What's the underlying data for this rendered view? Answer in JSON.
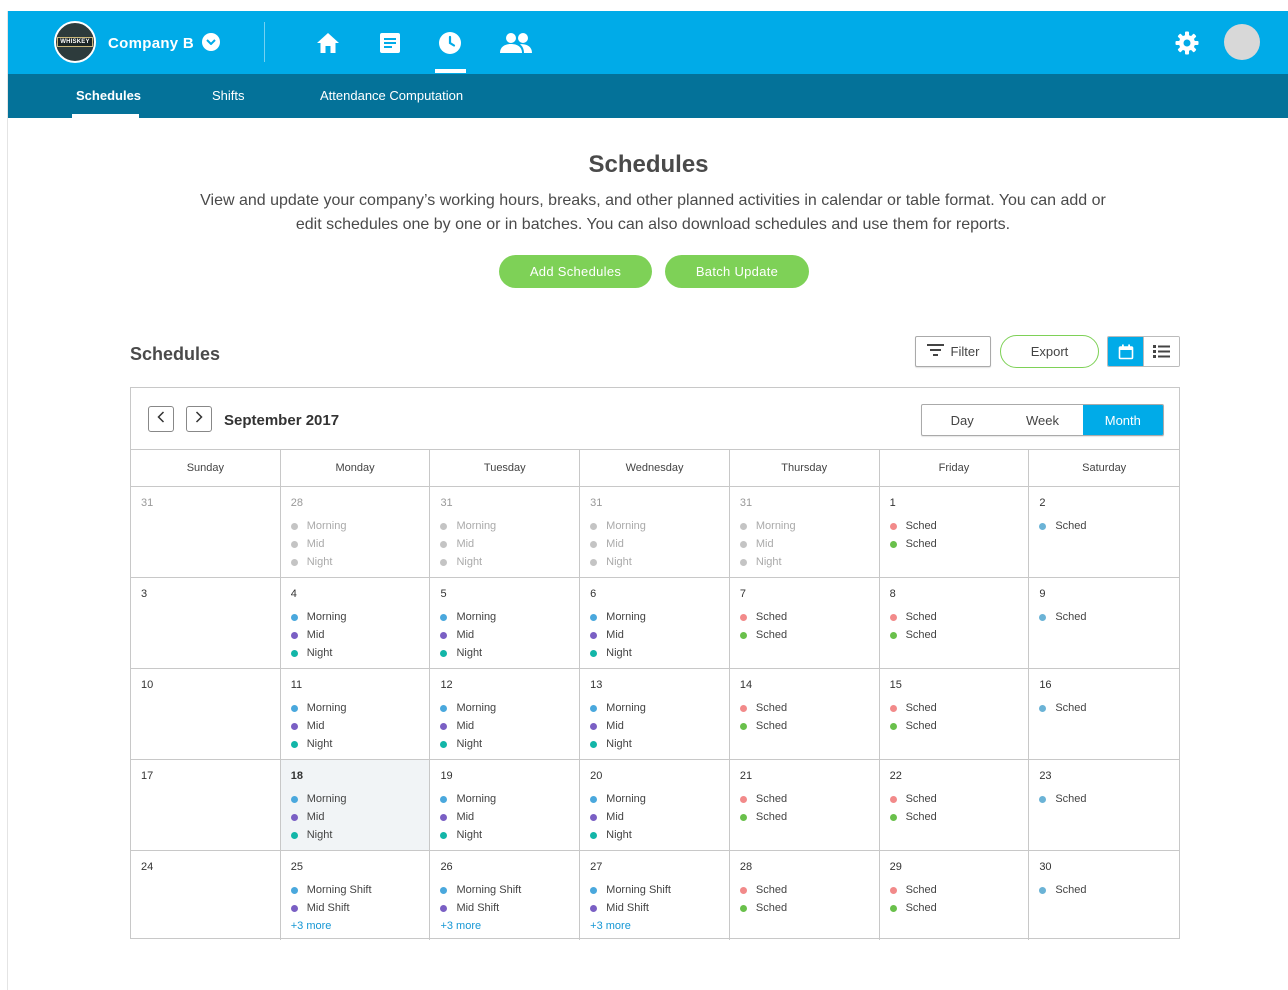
{
  "header": {
    "logo_text": "WHISKEY",
    "company_name": "Company B"
  },
  "nav_icons": [
    "home-icon",
    "document-icon",
    "clock-icon",
    "people-icon"
  ],
  "subnav": {
    "tabs": [
      "Schedules",
      "Shifts",
      "Attendance Computation"
    ]
  },
  "hero": {
    "title": "Schedules",
    "description": "View and update your company’s working hours, breaks, and other planned activities in calendar or table format. You can add or edit schedules one by one or in batches. You can also download schedules and use them for reports.",
    "add_label": "Add Schedules",
    "batch_label": "Batch Update"
  },
  "section": {
    "title": "Schedules",
    "filter_label": "Filter",
    "export_label": "Export"
  },
  "calendar": {
    "month": "September 2017",
    "views": [
      "Day",
      "Week",
      "Month"
    ],
    "active_view": "Month",
    "weekdays": [
      "Sunday",
      "Monday",
      "Tuesday",
      "Wednesday",
      "Thursday",
      "Friday",
      "Saturday"
    ]
  },
  "colors": {
    "accent": "#00abe8",
    "subnav": "#047299",
    "green": "#7ed157",
    "morning": "#4aa8dd",
    "mid": "#7a5fc4",
    "night": "#12b6a8",
    "sched_red": "#f28a8a",
    "sched_green": "#69c04b",
    "sched_blue": "#6bb3d6",
    "faded": "#c4c4c4",
    "more_link": "#1597d4"
  },
  "weeks": [
    [
      {
        "num": "31",
        "out": true,
        "events": []
      },
      {
        "num": "28",
        "out": true,
        "events": [
          [
            "Morning",
            "faded"
          ],
          [
            "Mid",
            "faded"
          ],
          [
            "Night",
            "faded"
          ]
        ]
      },
      {
        "num": "31",
        "out": true,
        "events": [
          [
            "Morning",
            "faded"
          ],
          [
            "Mid",
            "faded"
          ],
          [
            "Night",
            "faded"
          ]
        ]
      },
      {
        "num": "31",
        "out": true,
        "events": [
          [
            "Morning",
            "faded"
          ],
          [
            "Mid",
            "faded"
          ],
          [
            "Night",
            "faded"
          ]
        ]
      },
      {
        "num": "31",
        "out": true,
        "events": [
          [
            "Morning",
            "faded"
          ],
          [
            "Mid",
            "faded"
          ],
          [
            "Night",
            "faded"
          ]
        ]
      },
      {
        "num": "1",
        "events": [
          [
            "Sched",
            "sched_red"
          ],
          [
            "Sched",
            "sched_green"
          ]
        ]
      },
      {
        "num": "2",
        "events": [
          [
            "Sched",
            "sched_blue"
          ]
        ]
      }
    ],
    [
      {
        "num": "3",
        "events": []
      },
      {
        "num": "4",
        "events": [
          [
            "Morning",
            "morning"
          ],
          [
            "Mid",
            "mid"
          ],
          [
            "Night",
            "night"
          ]
        ]
      },
      {
        "num": "5",
        "events": [
          [
            "Morning",
            "morning"
          ],
          [
            "Mid",
            "mid"
          ],
          [
            "Night",
            "night"
          ]
        ]
      },
      {
        "num": "6",
        "events": [
          [
            "Morning",
            "morning"
          ],
          [
            "Mid",
            "mid"
          ],
          [
            "Night",
            "night"
          ]
        ]
      },
      {
        "num": "7",
        "events": [
          [
            "Sched",
            "sched_red"
          ],
          [
            "Sched",
            "sched_green"
          ]
        ]
      },
      {
        "num": "8",
        "events": [
          [
            "Sched",
            "sched_red"
          ],
          [
            "Sched",
            "sched_green"
          ]
        ]
      },
      {
        "num": "9",
        "events": [
          [
            "Sched",
            "sched_blue"
          ]
        ]
      }
    ],
    [
      {
        "num": "10",
        "events": []
      },
      {
        "num": "11",
        "events": [
          [
            "Morning",
            "morning"
          ],
          [
            "Mid",
            "mid"
          ],
          [
            "Night",
            "night"
          ]
        ]
      },
      {
        "num": "12",
        "events": [
          [
            "Morning",
            "morning"
          ],
          [
            "Mid",
            "mid"
          ],
          [
            "Night",
            "night"
          ]
        ]
      },
      {
        "num": "13",
        "events": [
          [
            "Morning",
            "morning"
          ],
          [
            "Mid",
            "mid"
          ],
          [
            "Night",
            "night"
          ]
        ]
      },
      {
        "num": "14",
        "events": [
          [
            "Sched",
            "sched_red"
          ],
          [
            "Sched",
            "sched_green"
          ]
        ]
      },
      {
        "num": "15",
        "events": [
          [
            "Sched",
            "sched_red"
          ],
          [
            "Sched",
            "sched_green"
          ]
        ]
      },
      {
        "num": "16",
        "events": [
          [
            "Sched",
            "sched_blue"
          ]
        ]
      }
    ],
    [
      {
        "num": "17",
        "events": []
      },
      {
        "num": "18",
        "today": true,
        "events": [
          [
            "Morning",
            "morning"
          ],
          [
            "Mid",
            "mid"
          ],
          [
            "Night",
            "night"
          ]
        ]
      },
      {
        "num": "19",
        "events": [
          [
            "Morning",
            "morning"
          ],
          [
            "Mid",
            "mid"
          ],
          [
            "Night",
            "night"
          ]
        ]
      },
      {
        "num": "20",
        "events": [
          [
            "Morning",
            "morning"
          ],
          [
            "Mid",
            "mid"
          ],
          [
            "Night",
            "night"
          ]
        ]
      },
      {
        "num": "21",
        "events": [
          [
            "Sched",
            "sched_red"
          ],
          [
            "Sched",
            "sched_green"
          ]
        ]
      },
      {
        "num": "22",
        "events": [
          [
            "Sched",
            "sched_red"
          ],
          [
            "Sched",
            "sched_green"
          ]
        ]
      },
      {
        "num": "23",
        "events": [
          [
            "Sched",
            "sched_blue"
          ]
        ]
      }
    ],
    [
      {
        "num": "24",
        "events": []
      },
      {
        "num": "25",
        "events": [
          [
            "Morning Shift",
            "morning"
          ],
          [
            "Mid Shift",
            "mid"
          ]
        ],
        "more": "+3 more"
      },
      {
        "num": "26",
        "events": [
          [
            "Morning Shift",
            "morning"
          ],
          [
            "Mid Shift",
            "mid"
          ]
        ],
        "more": "+3 more"
      },
      {
        "num": "27",
        "events": [
          [
            "Morning Shift",
            "morning"
          ],
          [
            "Mid Shift",
            "mid"
          ]
        ],
        "more": "+3 more"
      },
      {
        "num": "28",
        "events": [
          [
            "Sched",
            "sched_red"
          ],
          [
            "Sched",
            "sched_green"
          ]
        ]
      },
      {
        "num": "29",
        "events": [
          [
            "Sched",
            "sched_red"
          ],
          [
            "Sched",
            "sched_green"
          ]
        ]
      },
      {
        "num": "30",
        "events": [
          [
            "Sched",
            "sched_blue"
          ]
        ]
      }
    ]
  ]
}
